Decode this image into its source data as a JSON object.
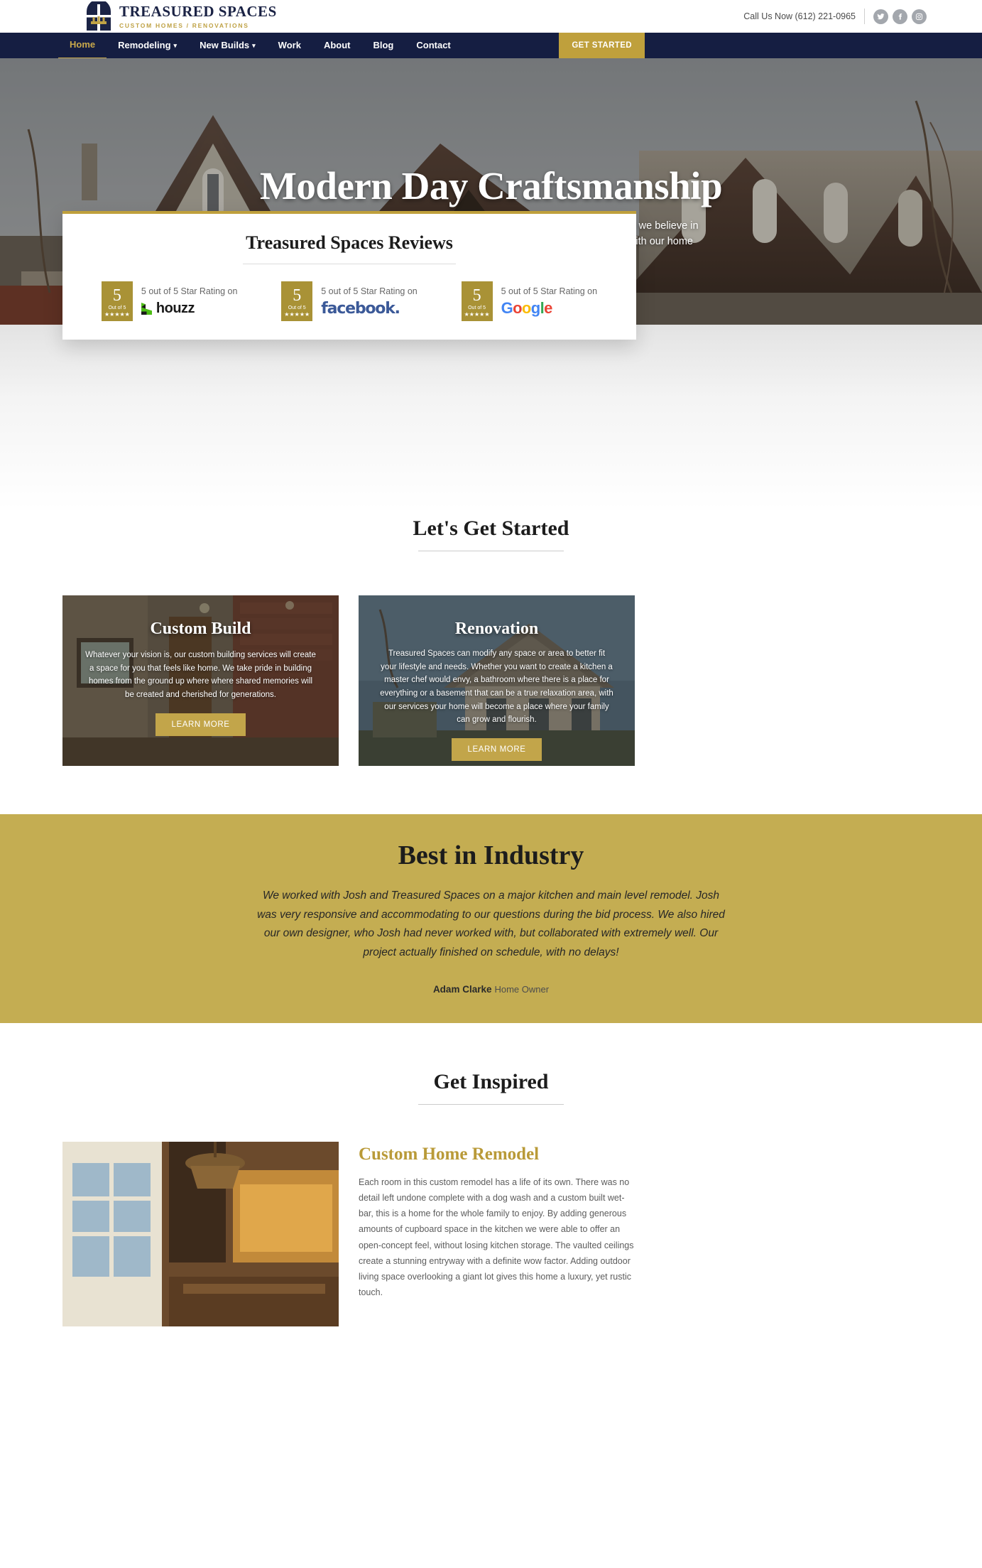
{
  "topbar": {
    "logo_title": "TREASURED SPACES",
    "logo_sub": "CUSTOM HOMES / RENOVATIONS",
    "call_us": "Call Us Now (612) 221-0965",
    "socials": [
      "twitter-icon",
      "facebook-icon",
      "instagram-icon"
    ]
  },
  "nav": {
    "items": [
      {
        "label": "Home",
        "active": true,
        "caret": false
      },
      {
        "label": "Remodeling",
        "active": false,
        "caret": true
      },
      {
        "label": "New Builds",
        "active": false,
        "caret": true
      },
      {
        "label": "Work",
        "active": false,
        "caret": false
      },
      {
        "label": "About",
        "active": false,
        "caret": false
      },
      {
        "label": "Blog",
        "active": false,
        "caret": false
      },
      {
        "label": "Contact",
        "active": false,
        "caret": false
      }
    ],
    "cta": "GET STARTED"
  },
  "hero": {
    "title": "Modern Day Craftsmanship",
    "subtitle": "We believe in building homes that our clients will cherish for years to come — we believe in creating Treasured Spaces. Find out how we can bring your dreams to life with our home remodeling and new construction services in Minneapolis."
  },
  "reviews": {
    "title": "Treasured Spaces Reviews",
    "items": [
      {
        "score": "5",
        "out_of": "Out of 5",
        "stars": "★★★★★",
        "label": "5 out of 5 Star Rating on",
        "brand": "houzz",
        "brand_icon": "houzz-logo"
      },
      {
        "score": "5",
        "out_of": "Out of 5",
        "stars": "★★★★★",
        "label": "5 out of 5 Star Rating on",
        "brand": "facebook.",
        "brand_icon": "facebook-logo"
      },
      {
        "score": "5",
        "out_of": "Out of 5",
        "stars": "★★★★★",
        "label": "5 out of 5 Star Rating on",
        "brand": "Google",
        "brand_icon": "google-logo"
      }
    ]
  },
  "lets_get_started": {
    "title": "Let's Get Started",
    "cards": [
      {
        "title": "Custom Build",
        "copy": "Whatever your vision is, our custom building services will create a space for you that feels like home. We take pride in building homes from the ground up where where shared memories will be created and cherished for generations.",
        "button": "LEARN MORE"
      },
      {
        "title": "Renovation",
        "copy": "Treasured Spaces can modify any space or area to better fit your lifestyle and needs. Whether you want to create a kitchen a master chef would envy, a bathroom where there is a place for everything or a basement that can be a true relaxation area, with our services your home will become a place where your family can grow and flourish.",
        "button": "LEARN MORE"
      }
    ]
  },
  "industry": {
    "title": "Best in Industry",
    "quote": "We worked with Josh and Treasured Spaces on a major kitchen and main level remodel. Josh was very responsive and accommodating to our questions during the bid process. We also hired our own designer, who Josh had never worked with, but collaborated with extremely well. Our project actually finished on schedule, with no delays!",
    "author_name": "Adam Clarke",
    "author_role": "Home Owner"
  },
  "get_inspired": {
    "title": "Get Inspired",
    "post_title": "Custom Home Remodel",
    "post_copy": "Each room in this custom remodel has a life of its own. There was no detail left undone complete with a dog wash and a custom built wet-bar, this is a home for the whole family to enjoy. By adding generous amounts of cupboard space in the kitchen we were able to offer an open-concept feel, without losing kitchen storage. The vaulted ceilings create a stunning entryway with a definite wow factor. Adding outdoor living space overlooking a giant lot gives this home a luxury, yet rustic touch."
  },
  "colors": {
    "navy": "#151e42",
    "gold": "#bfa03c",
    "gold_band": "#c4ad52",
    "badge_gold": "#a99236",
    "link_gold": "#b99a38"
  }
}
